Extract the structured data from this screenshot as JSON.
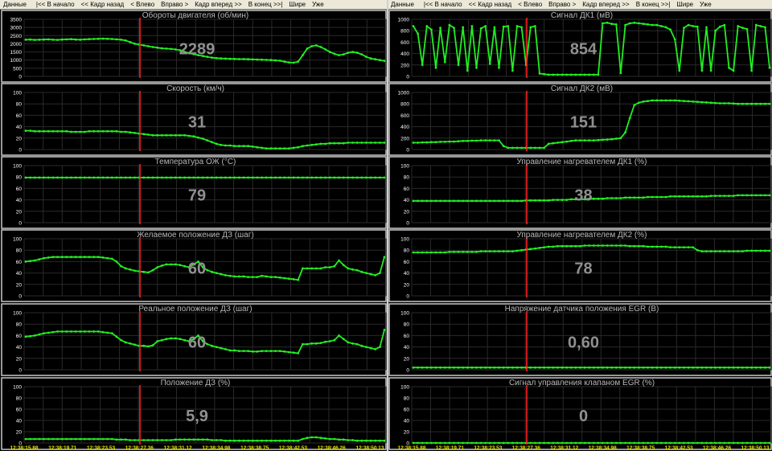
{
  "toolbar": {
    "items": [
      "Данные",
      "|<< В начало",
      "<< Кадр назад",
      "< Влево",
      "Вправо >",
      "Кадр вперед >>",
      "В конец >>|",
      "Шире",
      "Уже"
    ]
  },
  "time_labels": [
    "12:38:15.88",
    "12:38:19.71",
    "12:38:23.53",
    "12:38:27.36",
    "12:38:31.12",
    "12:38:34.98",
    "12:38:38.75",
    "12:38:42.53",
    "12:38:46.26",
    "12:38:50.13"
  ],
  "colors": {
    "line": "#22ee22",
    "cursor": "#ff2020",
    "grid": "#2a2a2a",
    "frame": "#c8c8c8",
    "title": "#b8b8b8",
    "value": "#909090",
    "axis": "#ffffff",
    "time": "#e8e800"
  },
  "chart_data": [
    {
      "type": "line",
      "title": "Обороты двигателя  (об/мин)",
      "ylim": [
        0,
        3500
      ],
      "yticks": [
        "0",
        "500",
        "1000",
        "1500",
        "2000",
        "2500",
        "3000",
        "3500"
      ],
      "value_label": "2289",
      "cursor_x": 0.32,
      "values": [
        2250,
        2260,
        2240,
        2250,
        2260,
        2270,
        2250,
        2240,
        2260,
        2270,
        2280,
        2260,
        2250,
        2270,
        2280,
        2290,
        2300,
        2310,
        2300,
        2290,
        2270,
        2250,
        2200,
        2100,
        2000,
        1950,
        1900,
        1850,
        1800,
        1760,
        1720,
        1700,
        1680,
        1650,
        1600,
        1500,
        1420,
        1360,
        1300,
        1250,
        1200,
        1150,
        1120,
        1100,
        1090,
        1080,
        1070,
        1060,
        1060,
        1050,
        1040,
        1030,
        1020,
        1010,
        1000,
        980,
        960,
        900,
        860,
        840,
        900,
        1300,
        1700,
        1850,
        1900,
        1800,
        1650,
        1500,
        1380,
        1300,
        1350,
        1450,
        1500,
        1450,
        1350,
        1200,
        1100,
        1050,
        1000,
        950
      ]
    },
    {
      "type": "line",
      "title": "Сигнал ДК1  (мВ)",
      "ylim": [
        0,
        1000
      ],
      "yticks": [
        "0",
        "200",
        "400",
        "600",
        "800",
        "1000"
      ],
      "value_label": "854",
      "cursor_x": 0.32,
      "values": [
        880,
        750,
        200,
        880,
        820,
        150,
        850,
        250,
        900,
        850,
        200,
        860,
        100,
        880,
        150,
        840,
        880,
        220,
        860,
        150,
        870,
        880,
        100,
        880,
        860,
        200,
        860,
        880,
        50,
        40,
        30,
        30,
        30,
        30,
        30,
        30,
        30,
        30,
        30,
        30,
        30,
        30,
        930,
        940,
        920,
        910,
        60,
        900,
        930,
        940,
        930,
        920,
        910,
        900,
        900,
        880,
        860,
        820,
        650,
        100,
        850,
        900,
        880,
        870,
        100,
        860,
        100,
        800,
        870,
        900,
        150,
        100,
        880,
        850,
        830,
        100,
        900,
        880,
        860,
        150
      ]
    },
    {
      "type": "line",
      "title": "Скорость  (км/ч)",
      "ylim": [
        0,
        100
      ],
      "yticks": [
        "0",
        "20",
        "40",
        "60",
        "80",
        "100"
      ],
      "value_label": "31",
      "cursor_x": 0.32,
      "values": [
        33,
        33,
        32,
        32,
        32,
        32,
        32,
        32,
        32,
        32,
        31,
        31,
        31,
        31,
        32,
        32,
        32,
        32,
        32,
        32,
        32,
        31,
        31,
        30,
        29,
        28,
        27,
        26,
        25,
        25,
        25,
        25,
        25,
        25,
        25,
        25,
        24,
        23,
        21,
        19,
        16,
        13,
        10,
        8,
        7,
        7,
        6,
        6,
        6,
        6,
        5,
        4,
        3,
        2,
        2,
        2,
        2,
        2,
        2,
        3,
        4,
        6,
        7,
        8,
        9,
        10,
        10,
        11,
        11,
        11,
        11,
        12,
        12,
        12,
        12,
        12,
        12,
        12,
        12,
        12
      ]
    },
    {
      "type": "line",
      "title": "Сигнал ДК2  (мВ)",
      "ylim": [
        0,
        1000
      ],
      "yticks": [
        "0",
        "200",
        "400",
        "600",
        "800",
        "1000"
      ],
      "value_label": "151",
      "cursor_x": 0.32,
      "values": [
        120,
        120,
        125,
        125,
        130,
        130,
        135,
        135,
        140,
        140,
        145,
        150,
        150,
        155,
        155,
        160,
        160,
        160,
        160,
        160,
        60,
        30,
        30,
        30,
        30,
        30,
        30,
        30,
        30,
        30,
        100,
        110,
        120,
        130,
        140,
        150,
        160,
        160,
        160,
        160,
        160,
        165,
        170,
        175,
        180,
        190,
        200,
        300,
        550,
        780,
        820,
        840,
        850,
        860,
        860,
        860,
        860,
        860,
        860,
        855,
        850,
        845,
        840,
        835,
        830,
        825,
        820,
        815,
        810,
        810,
        810,
        805,
        800,
        800,
        800,
        800,
        800,
        800,
        800,
        800
      ]
    },
    {
      "type": "line",
      "title": "Температура ОЖ  (°С)",
      "ylim": [
        0,
        100
      ],
      "yticks": [
        "0",
        "20",
        "40",
        "60",
        "80",
        "100"
      ],
      "value_label": "79",
      "cursor_x": 0.32,
      "values": [
        79,
        79,
        79,
        79,
        79,
        79,
        79,
        79,
        79,
        79,
        79,
        79,
        79,
        79,
        79,
        79,
        79,
        79,
        79,
        79,
        79,
        79,
        79,
        79,
        79,
        79,
        79,
        79,
        79,
        79,
        79,
        79,
        79,
        79,
        79,
        79,
        79,
        79,
        79,
        79,
        79,
        79,
        79,
        79,
        79,
        79,
        79,
        79,
        79,
        79,
        79,
        79,
        79,
        79,
        79,
        79,
        79,
        79,
        79,
        79,
        79,
        79,
        79,
        79,
        79,
        79,
        79,
        79,
        79,
        79,
        79,
        79,
        79,
        79,
        79,
        79,
        79,
        79,
        79,
        79
      ]
    },
    {
      "type": "line",
      "title": "Управление нагревателем ДК1  (%)",
      "ylim": [
        0,
        100
      ],
      "yticks": [
        "0",
        "20",
        "40",
        "60",
        "80",
        "100"
      ],
      "value_label": "38",
      "cursor_x": 0.32,
      "values": [
        38,
        38,
        38,
        38,
        38,
        38,
        38,
        38,
        38,
        38,
        38,
        38,
        38,
        38,
        38,
        38,
        38,
        38,
        38,
        38,
        38,
        38,
        38,
        38,
        38,
        39,
        39,
        39,
        39,
        39,
        39,
        40,
        40,
        40,
        40,
        41,
        41,
        41,
        41,
        42,
        42,
        42,
        42,
        43,
        43,
        43,
        43,
        44,
        44,
        44,
        44,
        44,
        45,
        45,
        45,
        45,
        45,
        46,
        46,
        46,
        46,
        46,
        46,
        46,
        46,
        46,
        47,
        47,
        47,
        47,
        47,
        47,
        48,
        48,
        48,
        48,
        48,
        48,
        48,
        48
      ]
    },
    {
      "type": "line",
      "title": "Желаемое положение ДЗ  (шаг)",
      "ylim": [
        0,
        100
      ],
      "yticks": [
        "0",
        "20",
        "40",
        "60",
        "80",
        "100"
      ],
      "value_label": "60",
      "cursor_x": 0.32,
      "values": [
        60,
        61,
        62,
        64,
        66,
        67,
        68,
        68,
        68,
        68,
        68,
        68,
        68,
        68,
        68,
        68,
        68,
        67,
        66,
        65,
        60,
        52,
        48,
        46,
        44,
        43,
        42,
        41,
        45,
        50,
        53,
        55,
        55,
        55,
        54,
        52,
        50,
        55,
        60,
        50,
        45,
        42,
        40,
        38,
        36,
        35,
        34,
        34,
        34,
        33,
        33,
        33,
        35,
        34,
        33,
        33,
        32,
        31,
        30,
        29,
        28,
        48,
        48,
        48,
        48,
        48,
        50,
        50,
        52,
        62,
        54,
        48,
        46,
        45,
        42,
        40,
        38,
        36,
        40,
        68
      ]
    },
    {
      "type": "line",
      "title": "Управление нагревателем ДК2  (%)",
      "ylim": [
        0,
        100
      ],
      "yticks": [
        "0",
        "20",
        "40",
        "60",
        "80",
        "100"
      ],
      "value_label": "78",
      "cursor_x": 0.32,
      "values": [
        76,
        76,
        76,
        76,
        76,
        76,
        76,
        76,
        77,
        77,
        77,
        77,
        77,
        77,
        77,
        78,
        78,
        78,
        78,
        78,
        78,
        78,
        78,
        79,
        80,
        81,
        82,
        83,
        84,
        85,
        86,
        86,
        87,
        87,
        87,
        87,
        87,
        87,
        88,
        88,
        88,
        88,
        88,
        88,
        88,
        88,
        88,
        88,
        87,
        87,
        87,
        87,
        86,
        86,
        86,
        86,
        86,
        85,
        85,
        85,
        85,
        85,
        85,
        80,
        78,
        78,
        78,
        78,
        78,
        78,
        78,
        78,
        78,
        78,
        79,
        79,
        79,
        79,
        79,
        79
      ]
    },
    {
      "type": "line",
      "title": "Реальное положение ДЗ  (шаг)",
      "ylim": [
        0,
        100
      ],
      "yticks": [
        "0",
        "20",
        "40",
        "60",
        "80",
        "100"
      ],
      "value_label": "60",
      "cursor_x": 0.32,
      "values": [
        58,
        59,
        60,
        62,
        64,
        65,
        66,
        67,
        67,
        67,
        67,
        67,
        67,
        67,
        67,
        67,
        67,
        66,
        65,
        64,
        58,
        52,
        48,
        46,
        44,
        42,
        42,
        41,
        43,
        50,
        52,
        54,
        55,
        55,
        54,
        52,
        50,
        54,
        60,
        50,
        45,
        42,
        40,
        38,
        36,
        34,
        34,
        33,
        33,
        33,
        32,
        32,
        33,
        33,
        33,
        33,
        33,
        32,
        31,
        30,
        29,
        45,
        45,
        46,
        46,
        47,
        49,
        50,
        52,
        60,
        54,
        48,
        46,
        45,
        42,
        40,
        38,
        36,
        40,
        70
      ]
    },
    {
      "type": "line",
      "title": "Напряжение датчика положения EGR  (В)",
      "ylim": [
        0,
        100
      ],
      "yticks": [
        "0",
        "20",
        "40",
        "60",
        "80",
        "100"
      ],
      "value_label": "0,60",
      "cursor_x": 0.32,
      "values": [
        4,
        4,
        4,
        4,
        4,
        4,
        4,
        4,
        4,
        4,
        4,
        4,
        4,
        4,
        4,
        4,
        4,
        4,
        4,
        4,
        4,
        4,
        4,
        4,
        4,
        4,
        4,
        4,
        4,
        4,
        4,
        4,
        4,
        4,
        4,
        4,
        4,
        4,
        4,
        4,
        4,
        4,
        4,
        4,
        4,
        4,
        4,
        4,
        4,
        4,
        4,
        4,
        4,
        4,
        4,
        4,
        4,
        4,
        4,
        4,
        4,
        4,
        4,
        4,
        4,
        4,
        4,
        4,
        4,
        4,
        4,
        4,
        4,
        4,
        4,
        4,
        4,
        4,
        4,
        4
      ]
    },
    {
      "type": "line",
      "title": "Положение ДЗ  (%)",
      "ylim": [
        0,
        100
      ],
      "yticks": [
        "0",
        "20",
        "40",
        "60",
        "80",
        "100"
      ],
      "value_label": "5,9",
      "cursor_x": 0.32,
      "values": [
        7,
        7,
        7,
        7,
        7,
        7,
        7,
        7,
        7,
        7,
        7,
        7,
        7,
        7,
        7,
        7,
        7,
        7,
        7,
        7,
        6,
        6,
        6,
        5,
        5,
        5,
        5,
        5,
        5,
        5,
        5,
        5,
        5,
        6,
        6,
        6,
        6,
        6,
        6,
        6,
        6,
        5,
        5,
        5,
        4,
        4,
        4,
        4,
        4,
        4,
        4,
        4,
        4,
        4,
        4,
        4,
        4,
        4,
        4,
        4,
        4,
        7,
        9,
        10,
        10,
        9,
        8,
        7,
        7,
        6,
        6,
        5,
        5,
        4,
        4,
        4,
        4,
        4,
        4,
        4
      ]
    },
    {
      "type": "line",
      "title": "Сигнал управления клапаном EGR  (%)",
      "ylim": [
        0,
        100
      ],
      "yticks": [
        "0",
        "20",
        "40",
        "60",
        "80",
        "100"
      ],
      "value_label": "0",
      "cursor_x": 0.32,
      "values": [
        0,
        0,
        0,
        0,
        0,
        0,
        0,
        0,
        0,
        0,
        0,
        0,
        0,
        0,
        0,
        0,
        0,
        0,
        0,
        0,
        0,
        0,
        0,
        0,
        0,
        0,
        0,
        0,
        0,
        0,
        0,
        0,
        0,
        0,
        0,
        0,
        0,
        0,
        0,
        0,
        0,
        0,
        0,
        0,
        0,
        0,
        0,
        0,
        0,
        0,
        0,
        0,
        0,
        0,
        0,
        0,
        0,
        0,
        0,
        0,
        0,
        0,
        0,
        0,
        0,
        0,
        0,
        0,
        0,
        0,
        0,
        0,
        0,
        0,
        0,
        0,
        0,
        0,
        0,
        0
      ]
    }
  ]
}
